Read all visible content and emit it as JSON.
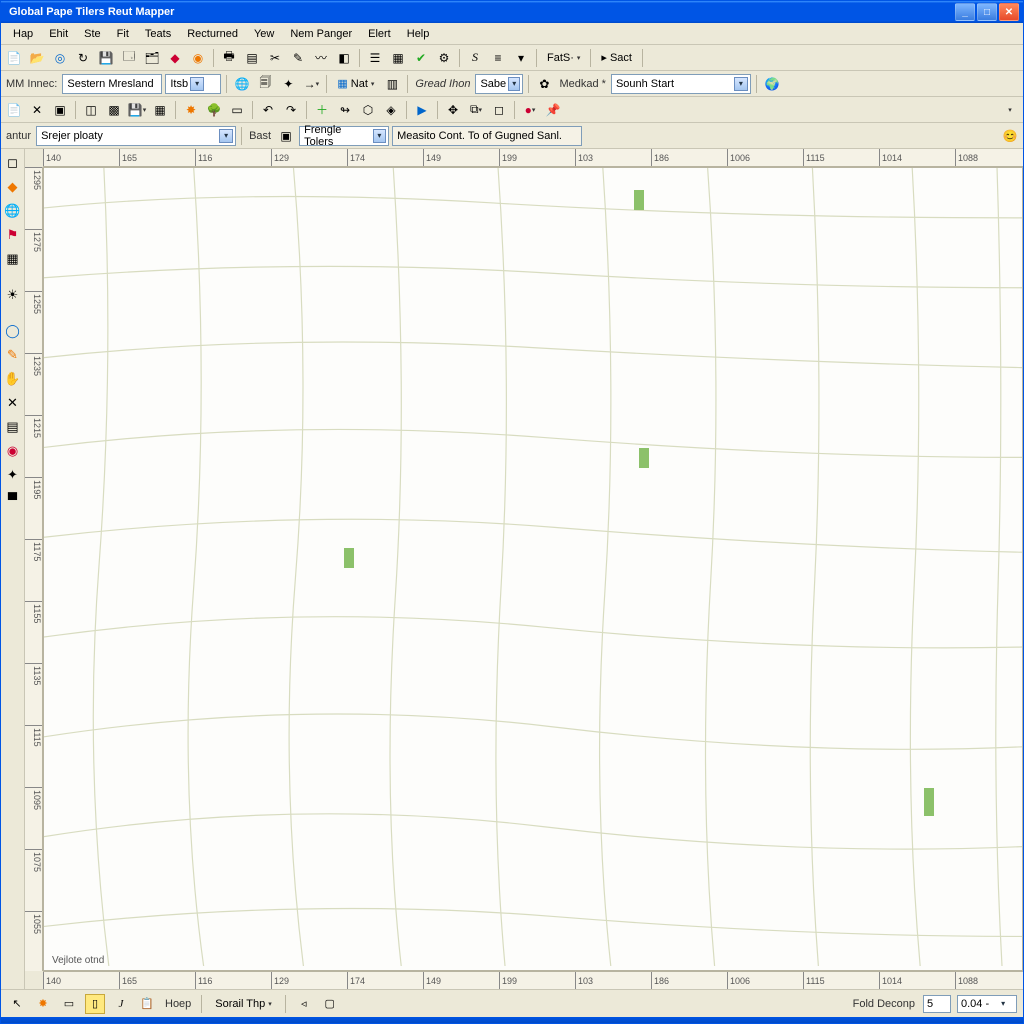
{
  "window": {
    "title": "Global Pape Tilers Reut Mapper"
  },
  "menu": [
    "Hap",
    "Ehit",
    "Ste",
    "Fit",
    "Teats",
    "Recturned",
    "Yew",
    "Nem Panger",
    "Elert",
    "Help"
  ],
  "toolbar1": {
    "fat_label": "FatS·",
    "sect_label": "Sact"
  },
  "toolbar2": {
    "name_label": "MM Innec:",
    "name_value": "Sestern Mresland",
    "name_sub": "Itsb",
    "nt_label": "Nat",
    "gread_label": "Gread Ihon",
    "sabe_label": "Sabe",
    "med_label": "Medkad *",
    "south_value": "Sounh Start"
  },
  "toolbar4": {
    "antur_label": "antur",
    "srejer_value": "Srejer ploaty",
    "bast_label": "Bast",
    "frengle_value": "Frengle Tolers",
    "measito_label": "Measito Cont. To  of Gugned Sanl."
  },
  "ruler_h_ticks": [
    "140",
    "165",
    "116",
    "129",
    "174",
    "149",
    "199",
    "103",
    "186",
    "1006",
    "1115",
    "1014",
    "1088"
  ],
  "ruler_v_ticks": [
    "1295",
    "1275",
    "1255",
    "1235",
    "1215",
    "1195",
    "1175",
    "1155",
    "1135",
    "1115",
    "1095",
    "1075",
    "1055"
  ],
  "canvas": {
    "label": "Vejlote otnd"
  },
  "statusbar": {
    "hoep": "Hoep",
    "soral": "Sorail Thp",
    "fold": "Fold Deconp",
    "num": "5",
    "extra": "0.04  -"
  }
}
